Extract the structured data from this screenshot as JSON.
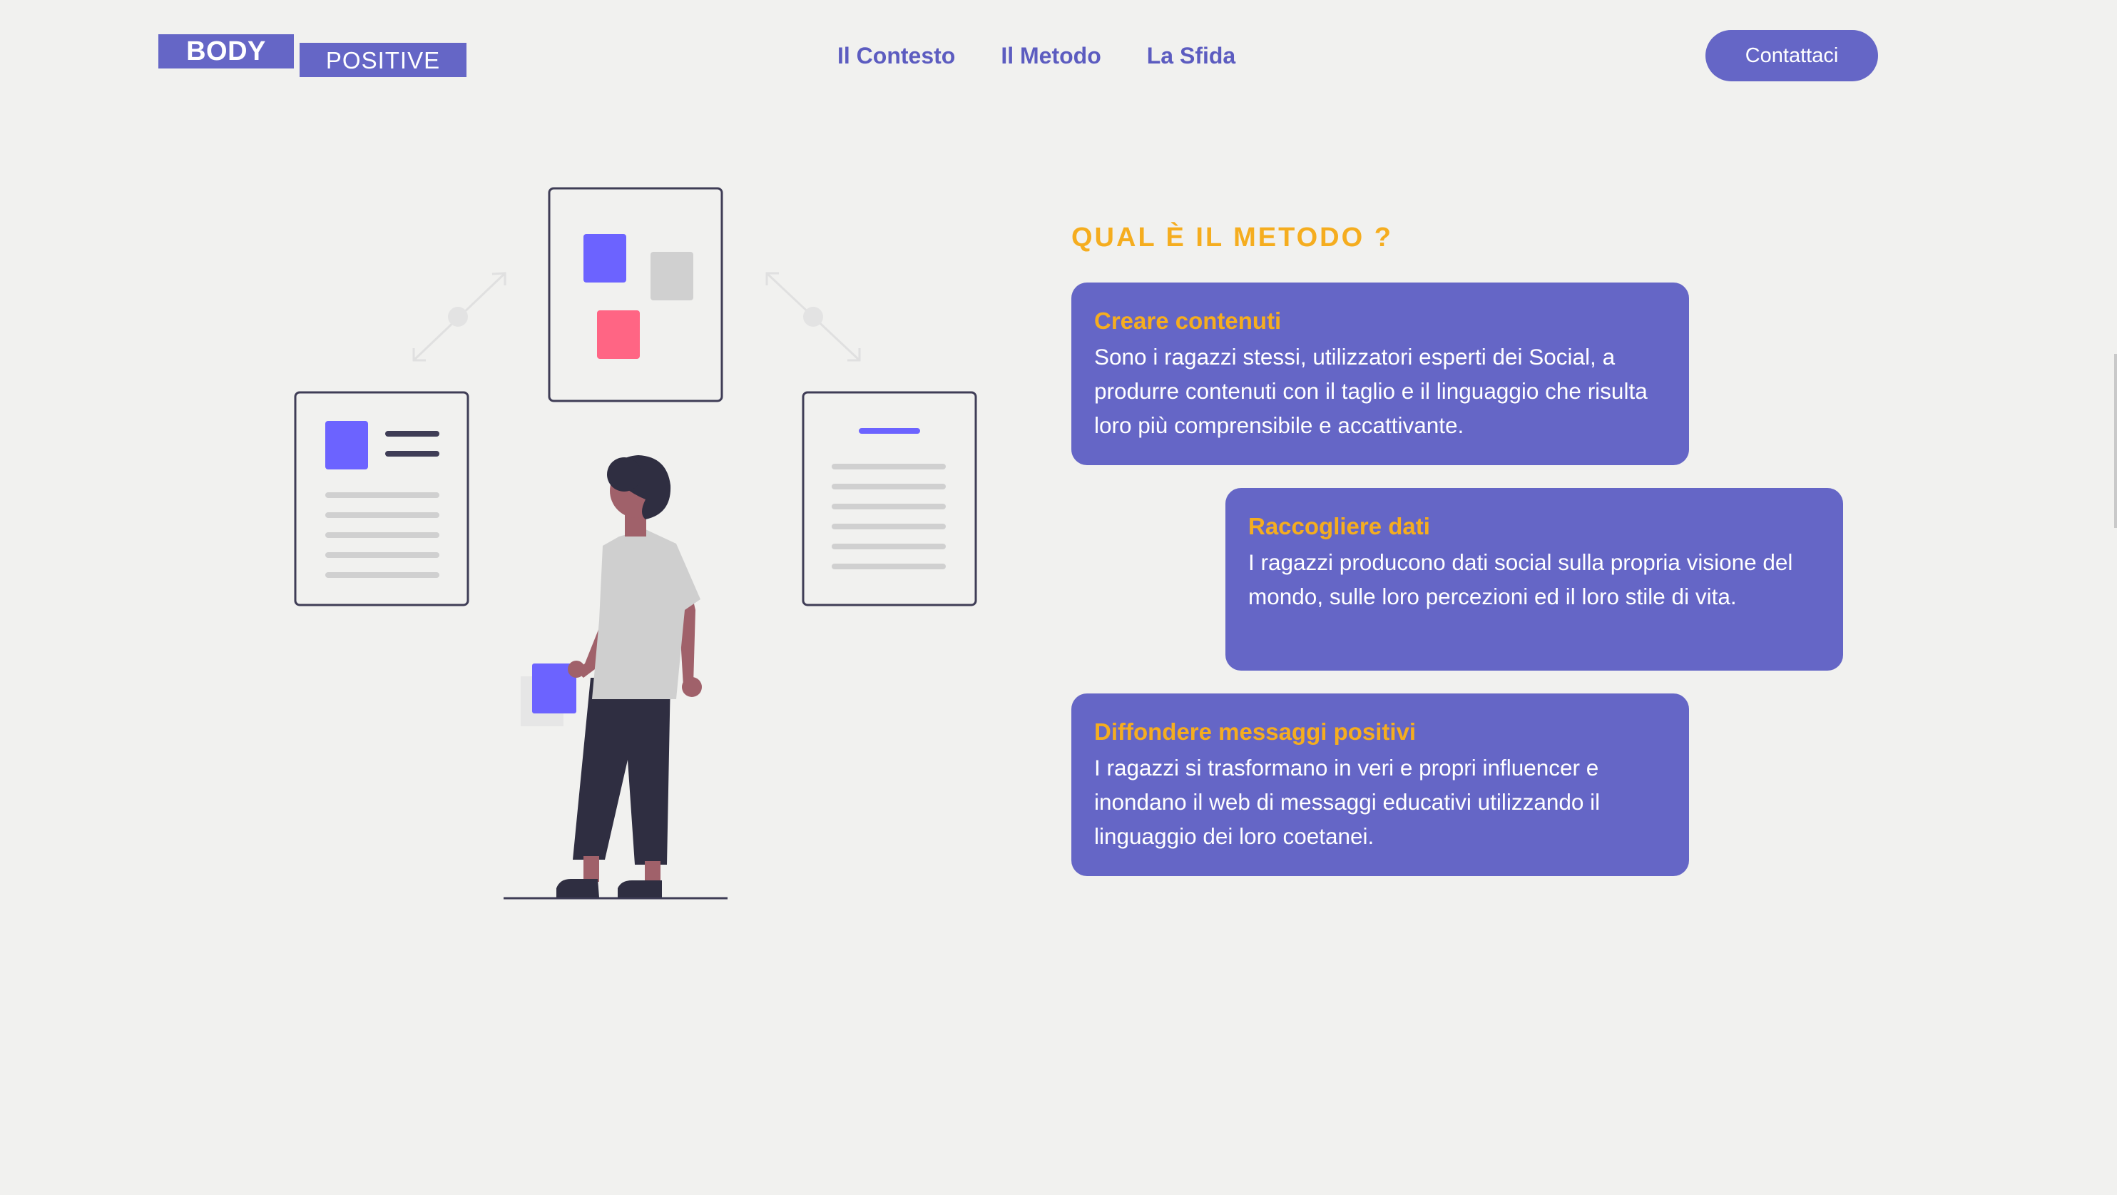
{
  "header": {
    "logo": {
      "word1": "BODY",
      "word2": "POSITIVE"
    },
    "nav": [
      {
        "label": "Il Contesto"
      },
      {
        "label": "Il Metodo"
      },
      {
        "label": "La Sfida"
      }
    ],
    "contact_label": "Contattaci"
  },
  "section": {
    "title": "QUAL È IL METODO ?",
    "cards": [
      {
        "title": "Creare contenuti",
        "text": "Sono i ragazzi stessi, utilizzatori esperti dei Social, a produrre contenuti con il taglio e il linguaggio che risulta loro più comprensibile e accattivante."
      },
      {
        "title": "Raccogliere dati",
        "text": "I ragazzi producono dati social sulla propria visione del mondo, sulle loro percezioni ed il loro stile di vita."
      },
      {
        "title": "Diffondere messaggi positivi",
        "text": "I ragazzi si trasformano in veri e propri influencer e inondano il web di messaggi educativi utilizzando il linguaggio dei loro coetanei."
      }
    ]
  },
  "colors": {
    "accent": "#6566c6",
    "title_orange": "#f5ad1f",
    "background": "#f1f1ef",
    "illustration_purple": "#6c63ff",
    "illustration_pink": "#ff6584"
  },
  "illustration": {
    "name": "person-viewing-documents-illustration"
  }
}
